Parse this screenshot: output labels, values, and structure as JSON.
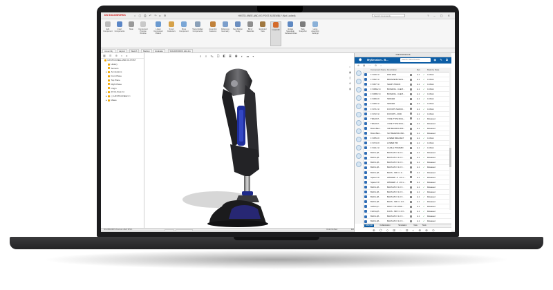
{
  "app": {
    "logo": "DS SOLIDWORKS",
    "title": "HKSTD-KNEE-AND-VG POST ASSEMBLY (Not Locked)",
    "search_placeholder": "Search Commands",
    "quick_access": "⌂ ▢ ⎙ ↶ ↷ ▸ ⚙",
    "window_buttons": "? – ▢ ✕"
  },
  "ribbon": {
    "buttons": [
      {
        "label": "Edit Component",
        "color": "#bcbcbc",
        "selected": false
      },
      {
        "label": "Insert Components",
        "color": "#5b86c6",
        "selected": false
      },
      {
        "label": "Mate",
        "color": "#9a9a9a",
        "selected": false
      },
      {
        "label": "Component Preview Window",
        "color": "#c9c9c9",
        "selected": false
      },
      {
        "label": "Linear Component Pattern",
        "color": "#6b9ad0",
        "selected": false
      },
      {
        "label": "Smart Fasteners",
        "color": "#d6a24a",
        "selected": false
      },
      {
        "label": "Move Component",
        "color": "#7aa6d6",
        "selected": false
      },
      {
        "label": "Show Hidden Components",
        "color": "#8aa0b8",
        "selected": false
      },
      {
        "label": "Assembly Features",
        "color": "#c0813a",
        "selected": false
      },
      {
        "label": "Reference Geometry",
        "color": "#7b9ecb",
        "selected": false
      },
      {
        "label": "New Motion Study",
        "color": "#6c8fc0",
        "selected": false
      },
      {
        "label": "Bill of Materials",
        "color": "#8f8f8f",
        "selected": false
      },
      {
        "label": "Exploded View",
        "color": "#a07840",
        "selected": false
      },
      {
        "label": "Instant3D",
        "color": "#d46a2a",
        "selected": true
      },
      {
        "label": "Update Speedpak Subassemblies",
        "color": "#5f89c2",
        "selected": false
      },
      {
        "label": "Take Snapshot",
        "color": "#7c7c7c",
        "selected": false
      },
      {
        "label": "Large Assembly Settings",
        "color": "#8bb1d8",
        "selected": false
      }
    ]
  },
  "command_tabs": [
    "Assembly",
    "Layout",
    "Sketch",
    "Markup",
    "Evaluate",
    "SOLIDWORKS Add-Ins"
  ],
  "feature_tree": {
    "toolbar": "▦ ☰ ⊕ ◐ ▸",
    "items": [
      {
        "label": "HKSTD-KNEE-AND-VG POST",
        "indent": 0,
        "expander": ""
      },
      {
        "label": "History",
        "indent": 5,
        "expander": ""
      },
      {
        "label": "Sensors",
        "indent": 5,
        "expander": ""
      },
      {
        "label": "Annotations",
        "indent": 5,
        "expander": "▸"
      },
      {
        "label": "Front Plane",
        "indent": 5,
        "expander": ""
      },
      {
        "label": "Top Plane",
        "indent": 5,
        "expander": ""
      },
      {
        "label": "Right Plane",
        "indent": 5,
        "expander": ""
      },
      {
        "label": "Origin",
        "indent": 5,
        "expander": ""
      },
      {
        "label": "(f) VG Post<1>",
        "indent": 5,
        "expander": "▸"
      },
      {
        "label": "(-) HKSTD-KNEE<1>",
        "indent": 5,
        "expander": "▸"
      },
      {
        "label": "Mates",
        "indent": 5,
        "expander": "▸"
      }
    ]
  },
  "viewport": {
    "hud": "⌕ ⌕ ✎ ◫ ◧ ▣ ◉ ◐ ▭ ▾",
    "side_tools": [
      "⌂",
      "▦",
      "◫",
      "⚙",
      "▤"
    ]
  },
  "bottom_tabs": [
    "Model",
    "Motion Study 1"
  ],
  "status": {
    "left": "SOLIDWORKS Premium 2022 SP2.1",
    "middle": "Under Defined",
    "edit": "Editing Assembly",
    "right": "MMGS"
  },
  "panel": {
    "header": "3DEXPERIENCE",
    "session": "MySession - B...",
    "search_placeholder": "Search Table Results",
    "bar_icons": "◉ ✎ ⧉",
    "toolbar": "⊕ ▤ ⋯ ⚙ ⌕",
    "columns": {
      "name": "Component Name",
      "description": "Description",
      "rev": "Rev",
      "maturity": "Maturity State"
    },
    "rows": [
      {
        "name": "17-040<1>",
        "desc": "ROD END",
        "rev": "A.1",
        "state": "In Work"
      },
      {
        "name": "17-062<1>",
        "desc": "BRONZE BUSHIN...",
        "rev": "A.1",
        "state": "In Work"
      },
      {
        "name": "17-067<1>",
        "desc": "SHAFT-TRACK",
        "rev": "A.1",
        "state": "In Work"
      },
      {
        "name": "17-068a<1>",
        "desc": "BUSHING - CLEVI...",
        "rev": "A.1",
        "state": "In Work"
      },
      {
        "name": "17-068b<1>",
        "desc": "BUSHING - CLEVI...",
        "rev": "A.1",
        "state": "In Work"
      },
      {
        "name": "17-069<2>",
        "desc": "SPACER",
        "rev": "A.1",
        "state": "In Work"
      },
      {
        "name": "17-069<1>",
        "desc": "SPACER",
        "rev": "A.1",
        "state": "In Work"
      },
      {
        "name": "17-071<1>",
        "desc": "FOX DPS SHOCK...",
        "rev": "A.1",
        "state": "In Work"
      },
      {
        "name": "17-072<1>",
        "desc": "FOX DPS - ROD",
        "rev": "A.1",
        "state": "In Work"
      },
      {
        "name": "TRACK P...",
        "desc": "YOKE TYPE ROLL...",
        "rev": "A.1",
        "state": "Released"
      },
      {
        "name": "TRACK P...",
        "desc": "YOKE TYPE ROLL...",
        "rev": "A.1",
        "state": "Released"
      },
      {
        "name": "BALL BEA...",
        "desc": "IHF BEARING #60...",
        "rev": "A.1",
        "state": "Released"
      },
      {
        "name": "BALL BEA...",
        "desc": "SAT BEARING #60...",
        "rev": "A.1",
        "state": "Released"
      },
      {
        "name": "17-055<2>",
        "desc": "LOWER BRACKET",
        "rev": "A.1",
        "state": "In Work"
      },
      {
        "name": "17-074<2>",
        "desc": "LOWER PIN",
        "rev": "A.1",
        "state": "In Work"
      },
      {
        "name": "17-041<1>",
        "desc": "4 HOLE PYRAMID",
        "rev": "A.1",
        "state": "In Work"
      },
      {
        "name": "BHCS-(M...",
        "desc": "BHCS M6 X 1.0 X...",
        "rev": "A.1",
        "state": "Released"
      },
      {
        "name": "BHCS-(M...",
        "desc": "BHCS M6 X 1.0 X...",
        "rev": "A.1",
        "state": "Released"
      },
      {
        "name": "BHCS-(M...",
        "desc": "BHCS M6 X 1.0 X...",
        "rev": "A.1",
        "state": "Released"
      },
      {
        "name": "BHCS-(M...",
        "desc": "BHCS M6 X 1.0 X...",
        "rev": "A.1",
        "state": "Released"
      },
      {
        "name": "BHCS-(M...",
        "desc": "BHCS - M6 X 1.0...",
        "rev": "A.1",
        "state": "Released"
      },
      {
        "name": "Spacer<2>",
        "desc": "WASHER - 6 x 16 x...",
        "rev": "A.1",
        "state": "Released"
      },
      {
        "name": "Spacer<2>",
        "desc": "WASHER - 6 x 16 x...",
        "rev": "A.1",
        "state": "Released"
      },
      {
        "name": "BHCS-(M...",
        "desc": "BHCS M6 X 1.0 X...",
        "rev": "A.1",
        "state": "Released"
      },
      {
        "name": "BHCS-(M...",
        "desc": "BHCS M6 X 1.0 X...",
        "rev": "A.1",
        "state": "Released"
      },
      {
        "name": "BHCS-(M...",
        "desc": "BHCS M6 X 1.0 X...",
        "rev": "A.1",
        "state": "Released"
      },
      {
        "name": "BHCS-(M...",
        "desc": "BHCS - M6 X 1.0 X...",
        "rev": "A.1",
        "state": "Released"
      },
      {
        "name": "SHSS-(1/...",
        "desc": "M6x2 X 30 LONG...",
        "rev": "A.1",
        "state": "Released"
      },
      {
        "name": "FHCS-(M...",
        "desc": "FHCS - M6 X 1.0 X...",
        "rev": "A.1",
        "state": "Released"
      },
      {
        "name": "BHCS-(M...",
        "desc": "BHCS M6 X 1.0 X...",
        "rev": "A.1",
        "state": "Released"
      },
      {
        "name": "BHCS-(M...",
        "desc": "BHCS M6 X 1.0 X...",
        "rev": "A.1",
        "state": "Released"
      }
    ],
    "bottom_tabs": [
      "Lifecycle",
      "Collaboration",
      "Simulation",
      "View",
      "Tools"
    ],
    "footer_icons": "⊕ ⌬ ◇ ⊞ ◌ ⊟ ◐ ⊕ ⊗ ⊙"
  }
}
